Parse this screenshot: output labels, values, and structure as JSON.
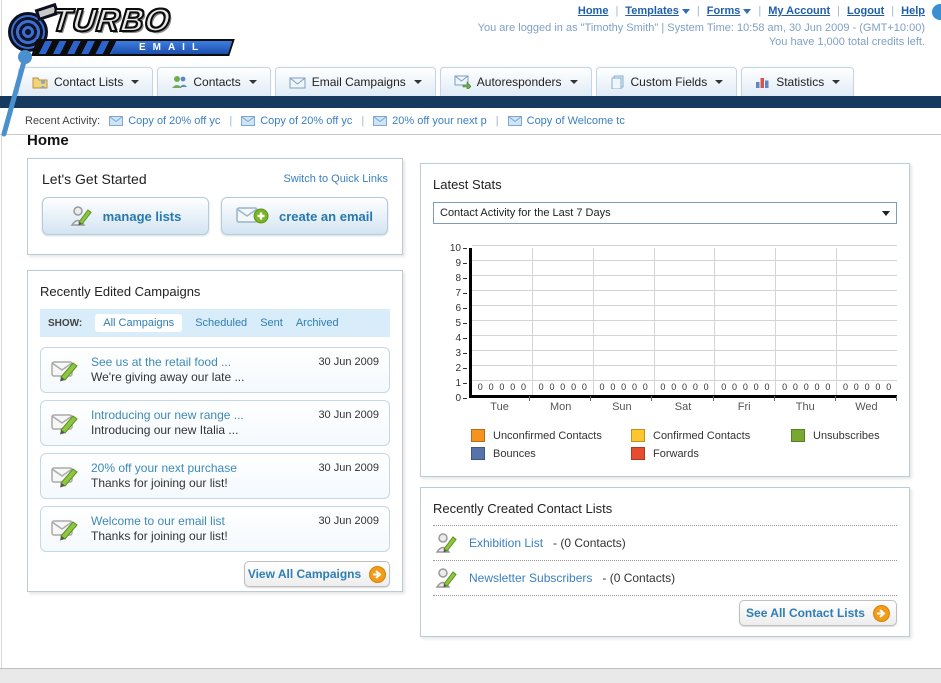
{
  "ui": {
    "separator": "|"
  },
  "header": {
    "logo_title": "TURBO",
    "logo_subtitle": "EMAIL",
    "links": [
      {
        "label": "Home"
      },
      {
        "label": "Templates",
        "dropdown": true
      },
      {
        "label": "Forms",
        "dropdown": true
      },
      {
        "label": "My Account"
      },
      {
        "label": "Logout"
      },
      {
        "label": "Help"
      }
    ],
    "login_info": "You are logged in as \"Timothy Smith\" | System Time: 10:58 am, 30 Jun 2009 - (GMT+10:00)",
    "credits_info": "You have 1,000 total credits left."
  },
  "nav_tabs": [
    {
      "label": "Contact Lists"
    },
    {
      "label": "Contacts"
    },
    {
      "label": "Email Campaigns"
    },
    {
      "label": "Autoresponders"
    },
    {
      "label": "Custom Fields"
    },
    {
      "label": "Statistics"
    }
  ],
  "recent_activity": {
    "label": "Recent Activity:",
    "items": [
      "Copy of 20% off yc",
      "Copy of 20% off yc",
      "20% off your next p",
      "Copy of Welcome tc"
    ]
  },
  "page_title": "Home",
  "get_started": {
    "title": "Let's Get Started",
    "switch_link": "Switch to Quick Links",
    "manage_lists_label": "manage lists",
    "create_email_label": "create an email"
  },
  "campaigns": {
    "title": "Recently Edited Campaigns",
    "show_label": "SHOW:",
    "tabs": [
      {
        "label": "All Campaigns",
        "active": true
      },
      {
        "label": "Scheduled",
        "active": false
      },
      {
        "label": "Sent",
        "active": false
      },
      {
        "label": "Archived",
        "active": false
      }
    ],
    "items": [
      {
        "title": "See us at the retail food ...",
        "subtitle": "We're giving away our late ...",
        "date": "30 Jun 2009"
      },
      {
        "title": "Introducing our new range ...",
        "subtitle": "Introducing our new Italia ...",
        "date": "30 Jun 2009"
      },
      {
        "title": "20% off your next purchase",
        "subtitle": "Thanks for joining our list!",
        "date": "30 Jun 2009"
      },
      {
        "title": "Welcome to our email list",
        "subtitle": "Thanks for joining our list!",
        "date": "30 Jun 2009"
      }
    ],
    "view_all_label": "View All Campaigns"
  },
  "latest_stats": {
    "title": "Latest Stats",
    "selected_option": "Contact Activity for the Last 7 Days"
  },
  "chart_data": {
    "type": "bar",
    "title": "Contact Activity for the Last 7 Days",
    "categories": [
      "Tue",
      "Mon",
      "Sun",
      "Sat",
      "Fri",
      "Thu",
      "Wed"
    ],
    "series": [
      {
        "name": "Unconfirmed Contacts",
        "color": "#f6921e",
        "values": [
          0,
          0,
          0,
          0,
          0,
          0,
          0
        ]
      },
      {
        "name": "Confirmed Contacts",
        "color": "#fdc62e",
        "values": [
          0,
          0,
          0,
          0,
          0,
          0,
          0
        ]
      },
      {
        "name": "Unsubscribes",
        "color": "#76a832",
        "values": [
          0,
          0,
          0,
          0,
          0,
          0,
          0
        ]
      },
      {
        "name": "Bounces",
        "color": "#5674a9",
        "values": [
          0,
          0,
          0,
          0,
          0,
          0,
          0
        ]
      },
      {
        "name": "Forwards",
        "color": "#e64c2e",
        "values": [
          0,
          0,
          0,
          0,
          0,
          0,
          0
        ]
      }
    ],
    "xlabel": "",
    "ylabel": "",
    "ylim": [
      0,
      10
    ],
    "yticks": [
      0,
      1,
      2,
      3,
      4,
      5,
      6,
      7,
      8,
      9,
      10
    ],
    "grid": true,
    "legend_position": "bottom",
    "value_labels": "each series shows 0 above axis for every day"
  },
  "contact_lists": {
    "title": "Recently Created Contact Lists",
    "items": [
      {
        "name": "Exhibition List",
        "detail": "- (0 Contacts)"
      },
      {
        "name": "Newsletter Subscribers",
        "detail": "- (0 Contacts)"
      }
    ],
    "see_all_label": "See All Contact Lists"
  }
}
